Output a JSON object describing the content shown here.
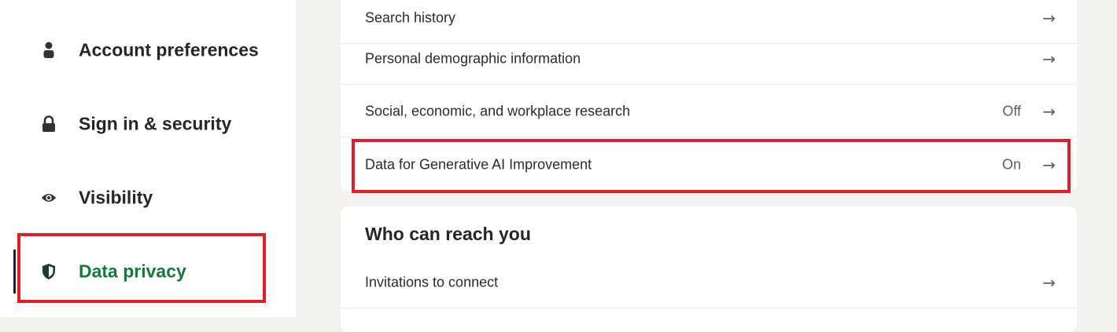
{
  "sidebar": {
    "items": [
      {
        "label": "Account preferences",
        "icon": "person-icon"
      },
      {
        "label": "Sign in & security",
        "icon": "lock-icon"
      },
      {
        "label": "Visibility",
        "icon": "eye-icon"
      },
      {
        "label": "Data privacy",
        "icon": "shield-icon",
        "active": true
      }
    ]
  },
  "main": {
    "rows_top": [
      {
        "label": "Search history",
        "status": ""
      },
      {
        "label": "Personal demographic information",
        "status": ""
      },
      {
        "label": "Social, economic, and workplace research",
        "status": "Off"
      },
      {
        "label": "Data for Generative AI Improvement",
        "status": "On"
      }
    ],
    "section": {
      "title": "Who can reach you",
      "rows": [
        {
          "label": "Invitations to connect",
          "status": ""
        }
      ]
    },
    "arrow": "→"
  },
  "colors": {
    "active_green": "#137a3a",
    "highlight_red": "#e11d2a",
    "page_bg": "#f3f2ef"
  }
}
